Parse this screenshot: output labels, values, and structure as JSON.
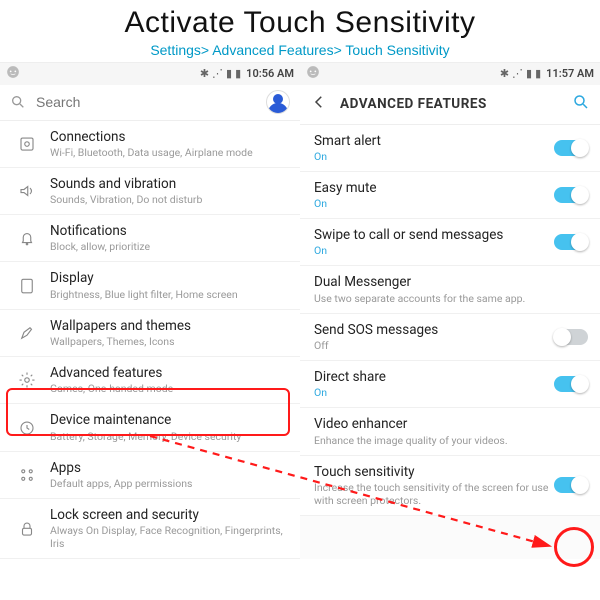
{
  "header": {
    "title": "Activate Touch Sensitivity",
    "breadcrumb": "Settings> Advanced Features> Touch Sensitivity"
  },
  "left": {
    "time": "10:56 AM",
    "search_placeholder": "Search",
    "items": [
      {
        "title": "Connections",
        "sub": "Wi-Fi, Bluetooth, Data usage, Airplane mode"
      },
      {
        "title": "Sounds and vibration",
        "sub": "Sounds, Vibration, Do not disturb"
      },
      {
        "title": "Notifications",
        "sub": "Block, allow, prioritize"
      },
      {
        "title": "Display",
        "sub": "Brightness, Blue light filter, Home screen"
      },
      {
        "title": "Wallpapers and themes",
        "sub": "Wallpapers, Themes, Icons"
      },
      {
        "title": "Advanced features",
        "sub": "Games, One-handed mode"
      },
      {
        "title": "Device maintenance",
        "sub": "Battery, Storage, Memory, Device security"
      },
      {
        "title": "Apps",
        "sub": "Default apps, App permissions"
      },
      {
        "title": "Lock screen and security",
        "sub": "Always On Display, Face Recognition, Fingerprints, Iris"
      }
    ]
  },
  "right": {
    "time": "11:57 AM",
    "title": "ADVANCED FEATURES",
    "items": [
      {
        "title": "Smart alert",
        "sub": "On",
        "on": true,
        "toggle": true
      },
      {
        "title": "Easy mute",
        "sub": "On",
        "on": true,
        "toggle": true
      },
      {
        "title": "Swipe to call or send messages",
        "sub": "On",
        "on": true,
        "toggle": true
      },
      {
        "title": "Dual Messenger",
        "sub": "Use two separate accounts for the same app.",
        "on": false,
        "toggle": false
      },
      {
        "title": "Send SOS messages",
        "sub": "Off",
        "on": false,
        "toggle": true
      },
      {
        "title": "Direct share",
        "sub": "On",
        "on": true,
        "toggle": true
      },
      {
        "title": "Video enhancer",
        "sub": "Enhance the image quality of your videos.",
        "on": false,
        "toggle": false
      },
      {
        "title": "Touch sensitivity",
        "sub": "Increase the touch sensitivity of the screen for use with screen protectors.",
        "on": true,
        "toggle": true
      }
    ]
  }
}
